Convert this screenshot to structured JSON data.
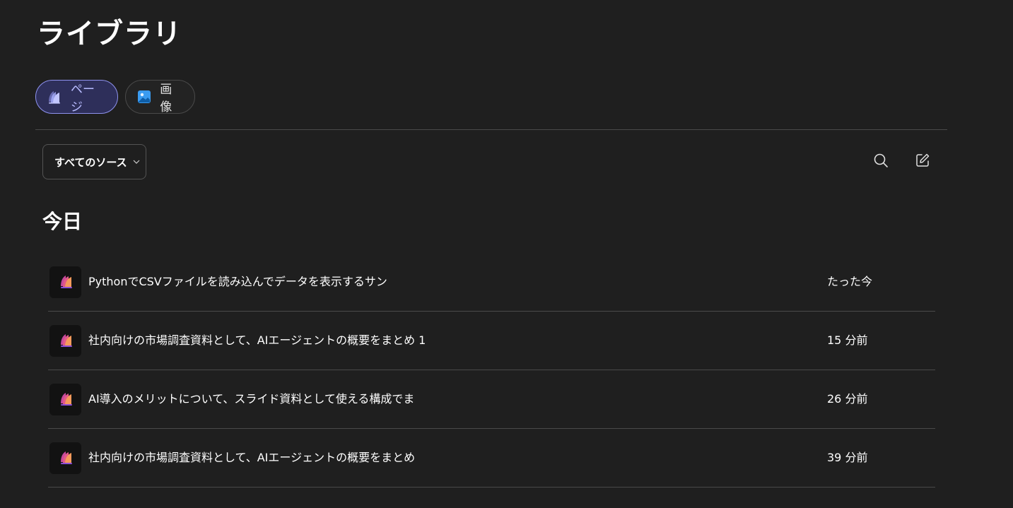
{
  "header": {
    "title": "ライブラリ"
  },
  "tabs": [
    {
      "label": "ページ",
      "icon": "pages-book-icon",
      "active": true
    },
    {
      "label": "画像",
      "icon": "image-icon",
      "active": false
    }
  ],
  "toolbar": {
    "source_filter_label": "すべてのソース",
    "search_icon": "search-icon",
    "new_page_icon": "new-page-icon"
  },
  "sections": [
    {
      "heading": "今日",
      "items": [
        {
          "title": "PythonでCSVファイルを読み込んでデータを表示するサン",
          "time": "たった今",
          "icon": "page-icon"
        },
        {
          "title": "社内向けの市場調査資料として、AIエージェントの概要をまとめ 1",
          "time": "15 分前",
          "icon": "page-icon"
        },
        {
          "title": "AI導入のメリットについて、スライド資料として使える構成でま",
          "time": "26 分前",
          "icon": "page-icon"
        },
        {
          "title": "社内向けの市場調査資料として、AIエージェントの概要をまとめ",
          "time": "39 分前",
          "icon": "page-icon"
        }
      ]
    }
  ],
  "colors": {
    "background": "#1f1f1f",
    "active_tab_border": "#8f93f0",
    "active_tab_bg": "#2e2f5a",
    "divider": "#4a4a4a"
  }
}
